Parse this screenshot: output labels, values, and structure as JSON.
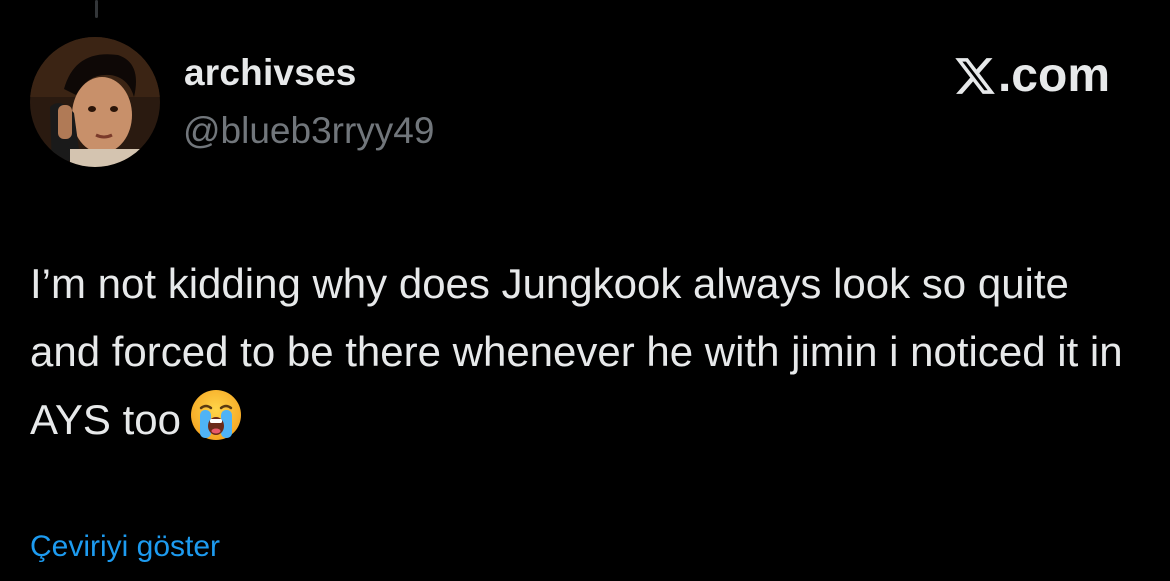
{
  "author": {
    "display_name": "archivses",
    "handle": "@blueb3rryy49",
    "avatar_icon": "profile-photo-avatar"
  },
  "brand": {
    "icon": "x-logo-icon",
    "text": ".com"
  },
  "tweet": {
    "text": "I’m not kidding why does Jungkook always look so quite and forced to be there whenever he with jimin i noticed it in AYS too",
    "emoji_icon": "loudly-crying-face-icon"
  },
  "translate": {
    "label": "Çeviriyi göster"
  },
  "colors": {
    "background": "#000000",
    "text": "#e7e9ea",
    "muted": "#71767b",
    "link": "#1d9bf0"
  }
}
